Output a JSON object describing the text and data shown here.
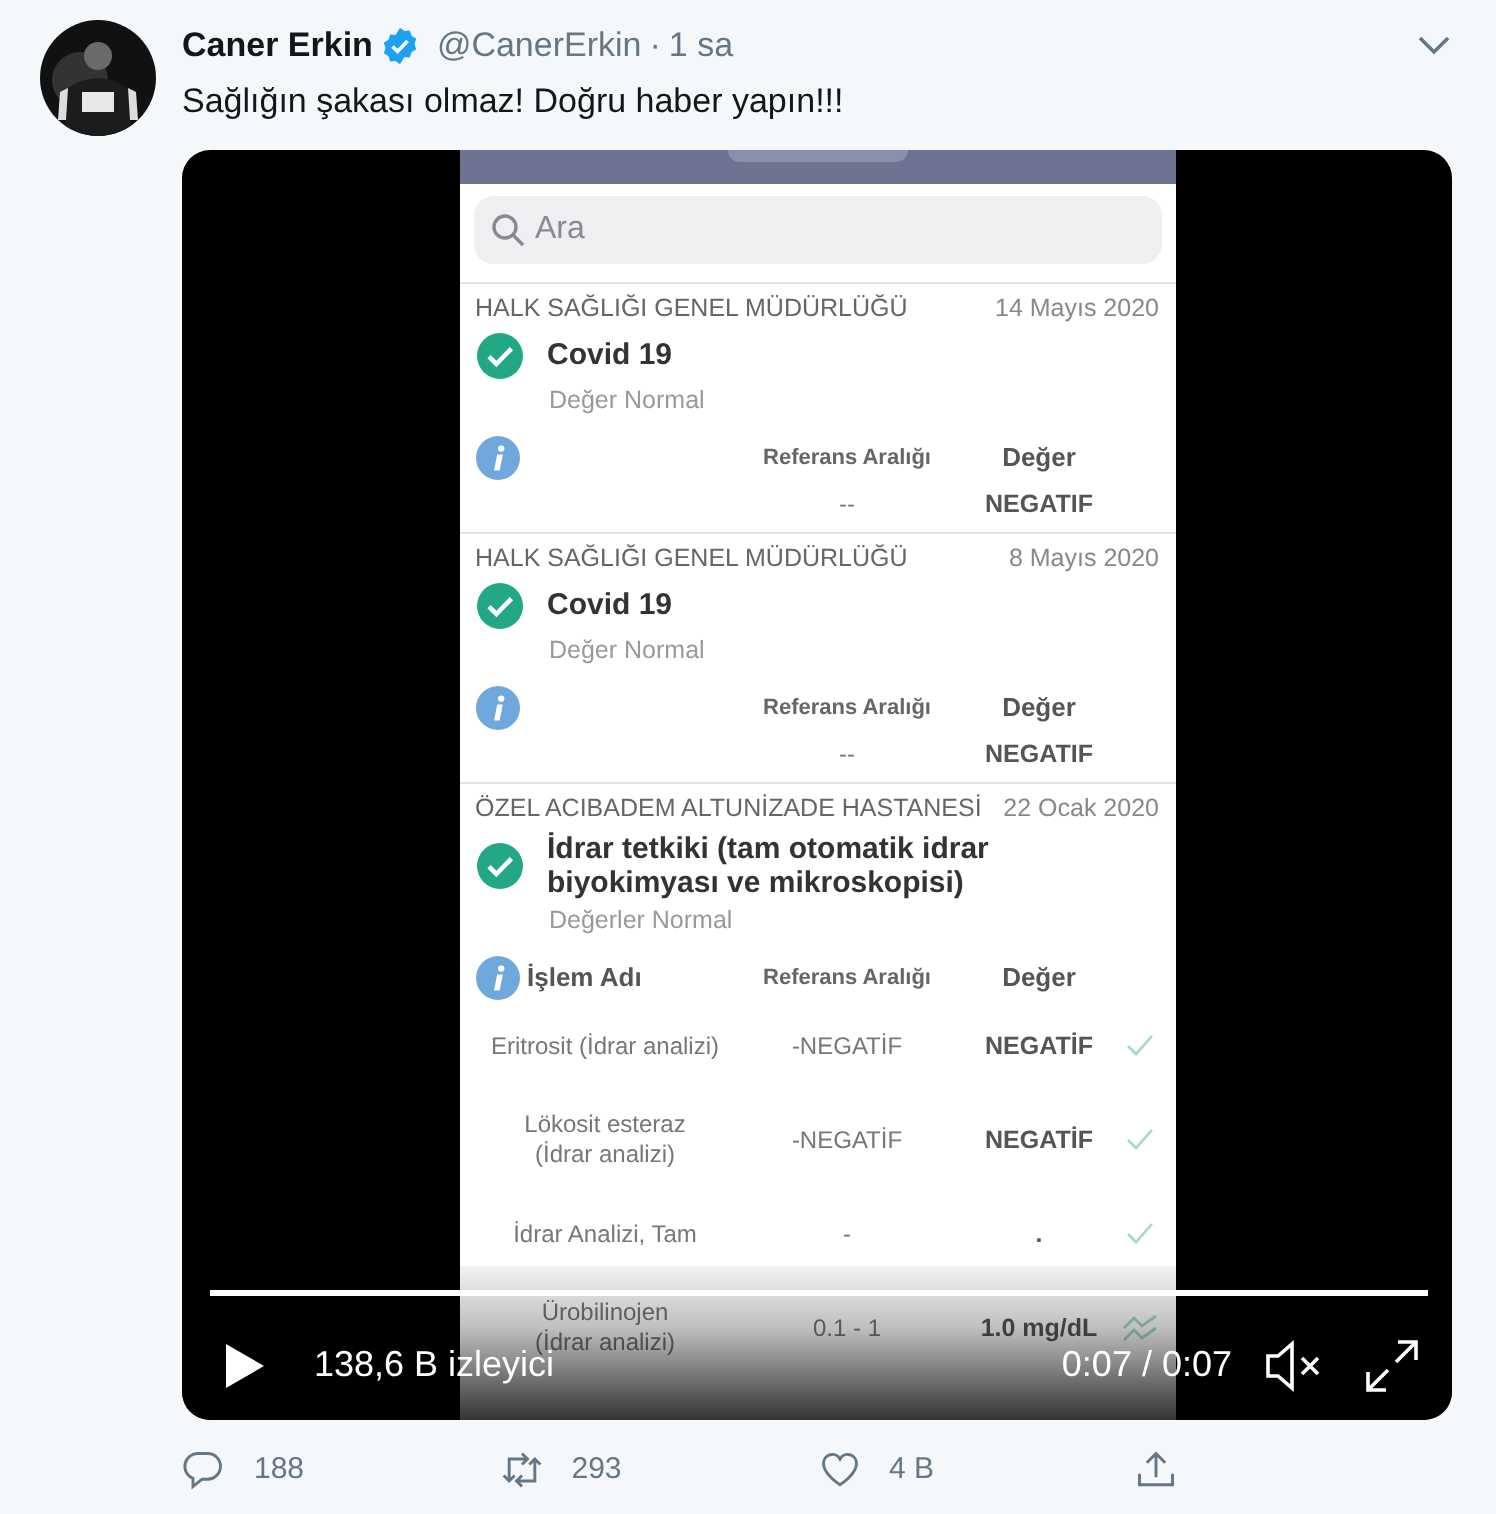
{
  "tweet": {
    "author": "Caner Erkin",
    "verified": true,
    "handle": "@CanerErkin",
    "separator": "·",
    "time": "1 sa",
    "text": "Sağlığın şakası olmaz! Doğru haber yapın!!!"
  },
  "video": {
    "app": {
      "search": {
        "placeholder": "Ara"
      },
      "records": [
        {
          "provider": "HALK SAĞLIĞI GENEL MÜDÜRLÜĞÜ",
          "date": "14 Mayıs 2020",
          "title": "Covid 19",
          "subtitle": "Değer Normal",
          "headers": [
            "Referans Aralığı",
            "Değer"
          ],
          "rows": [
            {
              "range": "--",
              "value": "NEGATIF"
            }
          ]
        },
        {
          "provider": "HALK SAĞLIĞI GENEL MÜDÜRLÜĞÜ",
          "date": "8 Mayıs 2020",
          "title": "Covid 19",
          "subtitle": "Değer Normal",
          "headers": [
            "Referans Aralığı",
            "Değer"
          ],
          "rows": [
            {
              "range": "--",
              "value": "NEGATIF"
            }
          ]
        },
        {
          "provider": "ÖZEL ACIBADEM ALTUNİZADE HASTANESİ",
          "date": "22 Ocak 2020",
          "title": "İdrar tetkiki (tam otomatik idrar biyokimyası ve mikroskopisi)",
          "subtitle": "Değerler Normal",
          "name_header": "İşlem Adı",
          "headers": [
            "Referans Aralığı",
            "Değer"
          ],
          "rows": [
            {
              "name": "Eritrosit (İdrar analizi)",
              "range": "-NEGATİF",
              "value": "NEGATİF",
              "kind": "check"
            },
            {
              "name": "Lökosit esteraz (İdrar analizi)",
              "range": "-NEGATİF",
              "value": "NEGATİF",
              "kind": "check"
            },
            {
              "name": "İdrar Analizi, Tam",
              "range": "-",
              "value": ".",
              "kind": "check"
            },
            {
              "name": "Ürobilinojen (İdrar analizi)",
              "range": "0.1 - 1",
              "value": "1.0 mg/dL",
              "kind": "trend"
            }
          ]
        }
      ]
    },
    "controls": {
      "level": 1,
      "views": "138,6 B izleyici",
      "time": "0:07 / 0:07",
      "muted": true
    }
  },
  "actions": [
    {
      "kind": "reply",
      "count": "188"
    },
    {
      "kind": "retweet",
      "count": "293"
    },
    {
      "kind": "like",
      "count": "4 B"
    },
    {
      "kind": "share"
    }
  ]
}
